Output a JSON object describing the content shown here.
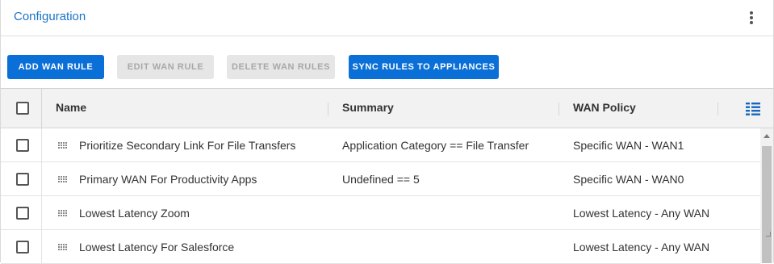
{
  "panel": {
    "title": "Configuration",
    "menu_icon": "kebab-vertical-icon"
  },
  "toolbar": {
    "add_label": "ADD WAN RULE",
    "edit_label": "EDIT WAN RULE",
    "delete_label": "DELETE WAN RULES",
    "sync_label": "SYNC RULES TO APPLIANCES",
    "edit_enabled": false,
    "delete_enabled": false
  },
  "colors": {
    "accent": "#0a6fd6",
    "title": "#1a73c7",
    "disabled_bg": "#e6e6e6",
    "disabled_text": "#a8a8a8"
  },
  "table": {
    "columns": {
      "name": "Name",
      "summary": "Summary",
      "policy": "WAN Policy"
    },
    "column_chooser_icon": "columns-icon",
    "drag_icon": "drag-handle-icon",
    "rows": [
      {
        "name": "Prioritize Secondary Link For File Transfers",
        "summary": "Application Category == File Transfer",
        "policy": "Specific WAN - WAN1",
        "checked": false
      },
      {
        "name": "Primary WAN For Productivity Apps",
        "summary": "Undefined == 5",
        "policy": "Specific WAN - WAN0",
        "checked": false
      },
      {
        "name": "Lowest Latency Zoom",
        "summary": "",
        "policy": "Lowest Latency - Any WAN",
        "checked": false
      },
      {
        "name": "Lowest Latency For Salesforce",
        "summary": "",
        "policy": "Lowest Latency - Any WAN",
        "checked": false
      }
    ]
  }
}
